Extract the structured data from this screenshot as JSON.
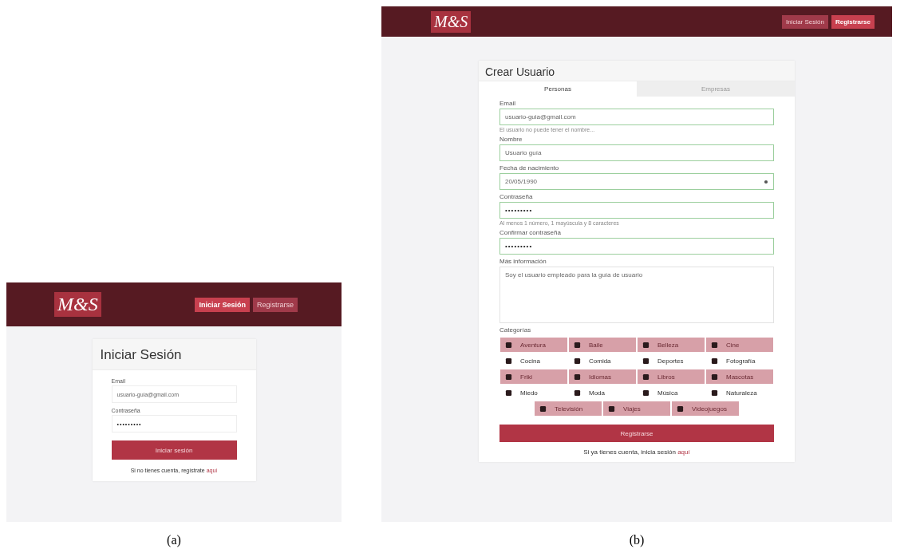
{
  "figures": [
    {
      "kind": "login",
      "caption": "(a)",
      "logo": "M&S",
      "nav_buttons": [
        {
          "label": "Iniciar Sesión",
          "selected": true
        },
        {
          "label": "Registrarse",
          "selected": false
        }
      ],
      "title": "Iniciar Sesión",
      "fields": [
        {
          "kind": "text",
          "label": "Email",
          "value": "usuario-guia@gmail.com"
        },
        {
          "kind": "password",
          "label": "Contraseña",
          "value": "•••••••••"
        }
      ],
      "submit": "Iniciar sesión",
      "footer_text": "Si no tienes cuenta, regístrate",
      "footer_link": "aquí"
    },
    {
      "kind": "register",
      "caption": "(b)",
      "logo": "M&S",
      "nav_buttons": [
        {
          "label": "Iniciar Sesión",
          "selected": false
        },
        {
          "label": "Registrarse",
          "selected": true
        }
      ],
      "title": "Crear Usuario",
      "tabs": [
        {
          "label": "Personas",
          "selected": true
        },
        {
          "label": "Empresas",
          "selected": false
        }
      ],
      "fields": [
        {
          "kind": "text",
          "label": "Email",
          "value": "usuario-guia@gmail.com",
          "hint": "El usuario no puede tener el nombre..."
        },
        {
          "kind": "text",
          "label": "Nombre",
          "value": "Usuario guía"
        },
        {
          "kind": "date",
          "label": "Fecha de nacimiento",
          "value": "20/05/1990"
        },
        {
          "kind": "password",
          "label": "Contraseña",
          "value": "•••••••••",
          "hint": "Al menos 1 número, 1 mayúscula y 8 caracteres"
        },
        {
          "kind": "password",
          "label": "Confirmar contraseña",
          "value": "•••••••••"
        },
        {
          "kind": "textarea",
          "label": "Más información",
          "value": "Soy el usuario empleado para la guía de usuario"
        }
      ],
      "categories_label": "Categorías",
      "categories": [
        {
          "label": "Aventura",
          "selected": true
        },
        {
          "label": "Baile",
          "selected": true
        },
        {
          "label": "Belleza",
          "selected": true
        },
        {
          "label": "Cine",
          "selected": true
        },
        {
          "label": "Cocina",
          "selected": false
        },
        {
          "label": "Comida",
          "selected": false
        },
        {
          "label": "Deportes",
          "selected": false
        },
        {
          "label": "Fotografía",
          "selected": false
        },
        {
          "label": "Friki",
          "selected": true
        },
        {
          "label": "Idiomas",
          "selected": true
        },
        {
          "label": "Libros",
          "selected": true
        },
        {
          "label": "Mascotas",
          "selected": true
        },
        {
          "label": "Miedo",
          "selected": false
        },
        {
          "label": "Moda",
          "selected": false
        },
        {
          "label": "Música",
          "selected": false
        },
        {
          "label": "Naturaleza",
          "selected": false
        },
        {
          "label": "Televisión",
          "selected": true
        },
        {
          "label": "Viajes",
          "selected": true
        },
        {
          "label": "Videojuegos",
          "selected": true
        }
      ],
      "submit": "Registrarse",
      "footer_text": "Si ya tienes cuenta, inicia sesión",
      "footer_link": "aquí"
    }
  ]
}
